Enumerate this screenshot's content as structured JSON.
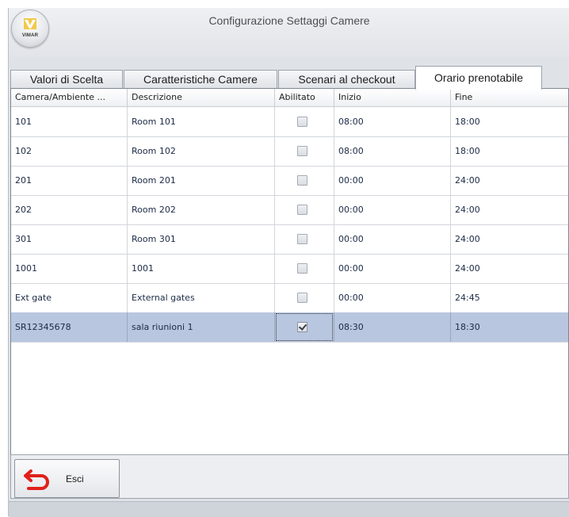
{
  "window": {
    "title": "Configurazione Settaggi Camere",
    "logo_text": "VIMAR"
  },
  "tabs": [
    {
      "label": "Valori di Scelta",
      "active": false
    },
    {
      "label": "Caratteristiche Camere",
      "active": false
    },
    {
      "label": "Scenari al checkout",
      "active": false
    },
    {
      "label": "Orario prenotabile",
      "active": true
    }
  ],
  "table": {
    "headers": [
      "Camera/Ambiente ...",
      "Descrizione",
      "Abilitato",
      "Inizio",
      "Fine"
    ],
    "rows": [
      {
        "camera": "101",
        "descrizione": "Room 101",
        "abilitato": false,
        "inizio": "08:00",
        "fine": "18:00"
      },
      {
        "camera": "102",
        "descrizione": "Room 102",
        "abilitato": false,
        "inizio": "08:00",
        "fine": "18:00"
      },
      {
        "camera": "201",
        "descrizione": "Room 201",
        "abilitato": false,
        "inizio": "00:00",
        "fine": "24:00"
      },
      {
        "camera": "202",
        "descrizione": "Room 202",
        "abilitato": false,
        "inizio": "00:00",
        "fine": "24:00"
      },
      {
        "camera": "301",
        "descrizione": "Room 301",
        "abilitato": false,
        "inizio": "00:00",
        "fine": "24:00"
      },
      {
        "camera": "1001",
        "descrizione": "1001",
        "abilitato": false,
        "inizio": "00:00",
        "fine": "24:00"
      },
      {
        "camera": "Ext gate",
        "descrizione": "External gates",
        "abilitato": false,
        "inizio": "00:00",
        "fine": "24:45"
      },
      {
        "camera": "SR12345678",
        "descrizione": "sala riunioni 1",
        "abilitato": true,
        "inizio": "08:30",
        "fine": "18:30",
        "selected": true
      }
    ]
  },
  "footer": {
    "exit_label": "Esci",
    "exit_icon": "back-arrow-icon"
  },
  "colors": {
    "selected_row": "#b8c6df",
    "exit_icon": "#e0201b",
    "logo_mark": "#e8b021"
  }
}
